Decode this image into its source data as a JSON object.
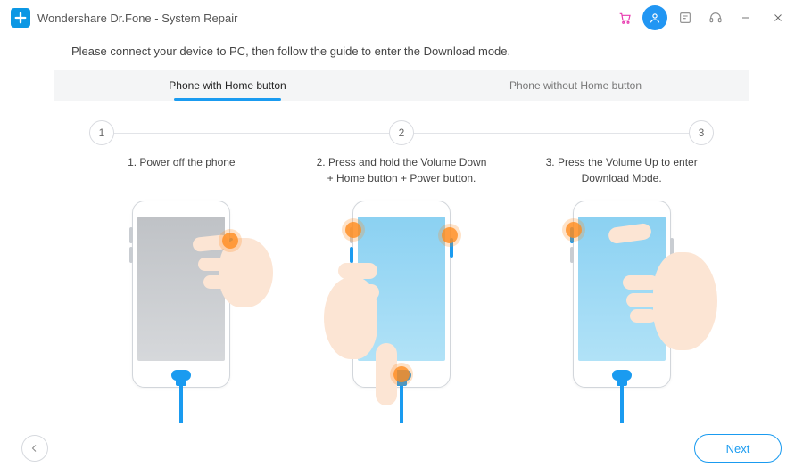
{
  "titlebar": {
    "app_title": "Wondershare Dr.Fone - System Repair"
  },
  "instruction": "Please connect your device to PC, then follow the guide to enter the Download mode.",
  "tabs": {
    "with_home": "Phone with Home button",
    "without_home": "Phone without Home button"
  },
  "steps": {
    "num1": "1",
    "num2": "2",
    "num3": "3",
    "cap1": "1. Power off the phone",
    "cap2": "2. Press and hold the Volume Down + Home button + Power button.",
    "cap3": "3. Press the Volume Up to enter Download Mode."
  },
  "footer": {
    "next_label": "Next"
  }
}
